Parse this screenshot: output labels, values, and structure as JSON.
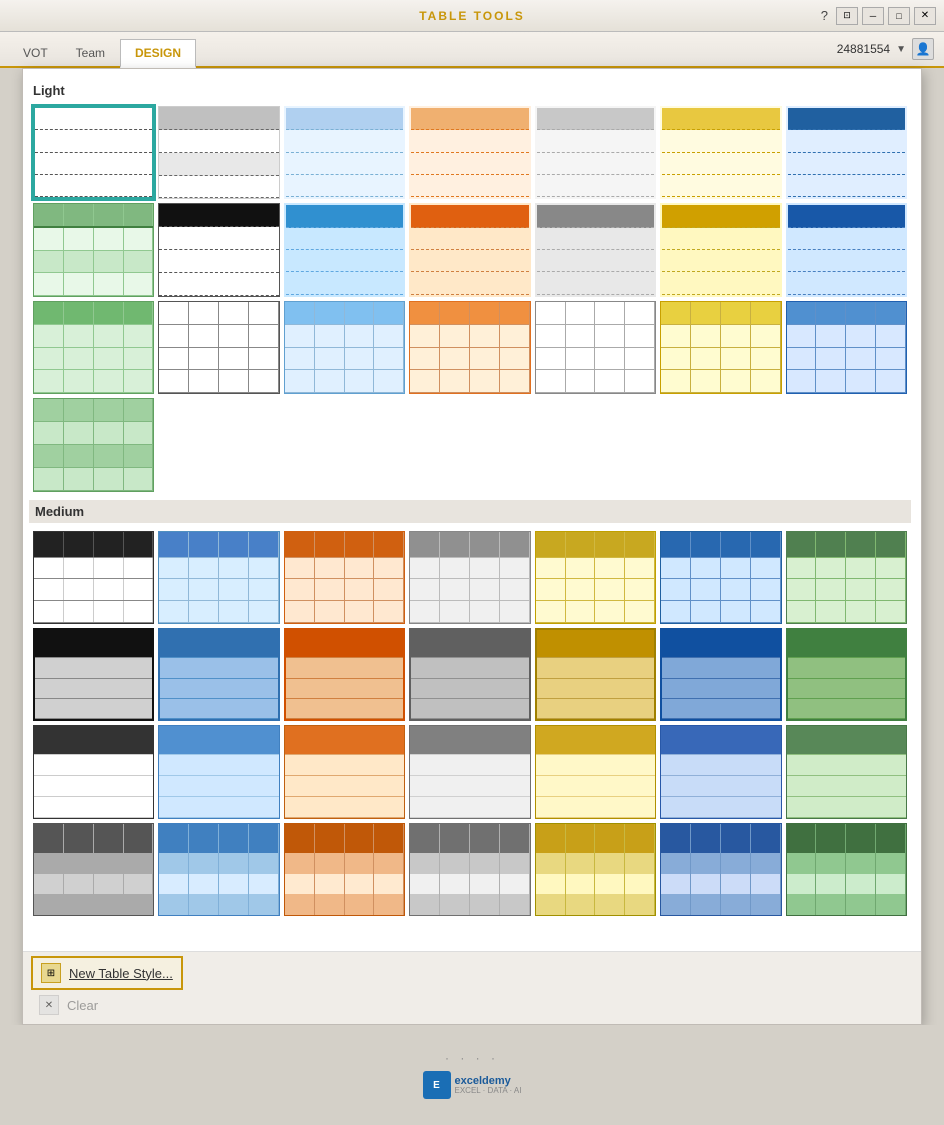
{
  "app": {
    "title": "TABLE TOOLS",
    "tabs": [
      "VOT",
      "Team",
      "DESIGN"
    ],
    "active_tab": "DESIGN",
    "user_id": "24881554",
    "window_controls": [
      "help",
      "restore",
      "minimize",
      "maximize",
      "close"
    ]
  },
  "sections": {
    "light": {
      "label": "Light",
      "rows": 4
    },
    "medium": {
      "label": "Medium",
      "rows": 4
    }
  },
  "footer": {
    "new_table_style_label": "New Table Style...",
    "clear_label": "Clear"
  },
  "dots": "· · · ·",
  "logo": "exceldemy"
}
